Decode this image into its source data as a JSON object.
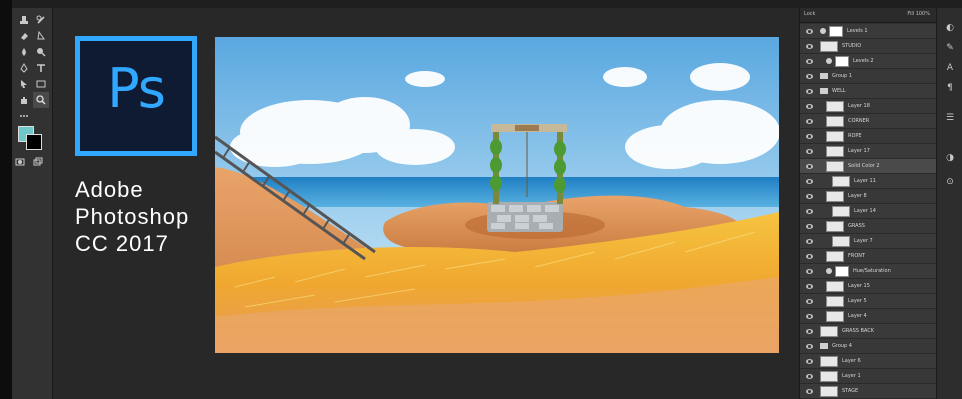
{
  "colors": {
    "ps_blue": "#31a8ff",
    "ps_bg": "#0f1a33",
    "foreground_swatch": "#6fc8c8",
    "background_swatch": "#000000"
  },
  "logo": {
    "text": "Ps"
  },
  "caption": {
    "line1": "Adobe",
    "line2": "Photoshop",
    "line3": "CC 2017"
  },
  "tools": [
    "stamp-tool-icon",
    "history-brush-icon",
    "eraser-tool-icon",
    "gradient-tool-icon",
    "blur-tool-icon",
    "dodge-tool-icon",
    "pen-tool-icon",
    "type-tool-icon",
    "path-select-icon",
    "rectangle-tool-icon",
    "hand-tool-icon",
    "zoom-tool-icon",
    "more-tools-icon",
    "quick-mask-icon",
    "screen-mode-icon"
  ],
  "layers_panel": {
    "header_left": "Lock",
    "header_right": "Fill 100%",
    "layers": [
      {
        "name": "Levels 1",
        "type": "adjustment",
        "indent": 1
      },
      {
        "name": "STUDIO",
        "type": "pixel",
        "indent": 1
      },
      {
        "name": "Levels 2",
        "type": "adjustment",
        "indent": 2
      },
      {
        "name": "Group 1",
        "type": "group",
        "indent": 1
      },
      {
        "name": "WELL",
        "type": "group",
        "indent": 1
      },
      {
        "name": "Layer 18",
        "type": "pixel",
        "indent": 2
      },
      {
        "name": "CORNER",
        "type": "pixel",
        "indent": 2
      },
      {
        "name": "ROPE",
        "type": "pixel",
        "indent": 2
      },
      {
        "name": "Layer 17",
        "type": "pixel",
        "indent": 2
      },
      {
        "name": "Solid Color 2",
        "type": "pixel",
        "indent": 2
      },
      {
        "name": "Layer 11",
        "type": "pixel",
        "indent": 3
      },
      {
        "name": "Layer 8",
        "type": "pixel",
        "indent": 2
      },
      {
        "name": "Layer 14",
        "type": "pixel",
        "indent": 3
      },
      {
        "name": "GRASS",
        "type": "pixel",
        "indent": 2
      },
      {
        "name": "Layer 7",
        "type": "pixel",
        "indent": 3
      },
      {
        "name": "FRONT",
        "type": "pixel",
        "indent": 2
      },
      {
        "name": "Hue/Saturation",
        "type": "adjustment",
        "indent": 2
      },
      {
        "name": "Layer 15",
        "type": "pixel",
        "indent": 2
      },
      {
        "name": "Layer 5",
        "type": "pixel",
        "indent": 2
      },
      {
        "name": "Layer 4",
        "type": "pixel",
        "indent": 2
      },
      {
        "name": "GRASS BACK",
        "type": "pixel",
        "indent": 1
      },
      {
        "name": "Group 4",
        "type": "group",
        "indent": 1
      },
      {
        "name": "Layer 6",
        "type": "pixel",
        "indent": 1
      },
      {
        "name": "Layer 1",
        "type": "pixel",
        "indent": 1
      },
      {
        "name": "STAGE",
        "type": "pixel",
        "indent": 1
      }
    ]
  },
  "right_strip_icons": [
    "color-panel-icon",
    "brush-panel-icon",
    "character-panel-icon",
    "paragraph-panel-icon",
    "properties-panel-icon",
    "adjustments-panel-icon",
    "styles-panel-icon"
  ]
}
